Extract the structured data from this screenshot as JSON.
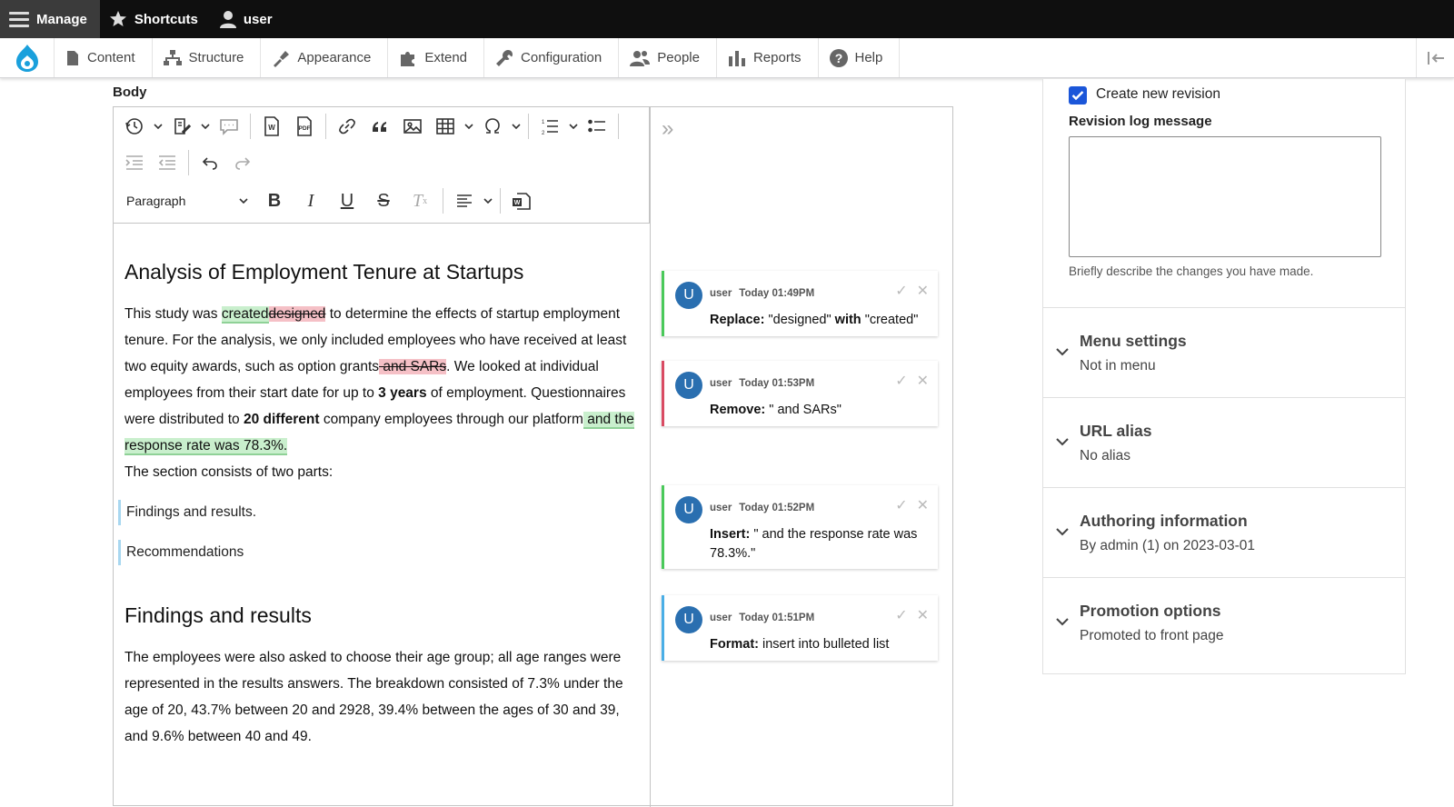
{
  "topbar": {
    "manage": "Manage",
    "shortcuts": "Shortcuts",
    "user": "user"
  },
  "tray": {
    "items": [
      "Content",
      "Structure",
      "Appearance",
      "Extend",
      "Configuration",
      "People",
      "Reports",
      "Help"
    ]
  },
  "editor": {
    "field_label": "Body",
    "paragraph_select": "Paragraph",
    "heading1": "Analysis of Employment Tenure at Startups",
    "p1": {
      "a": "This study was ",
      "ins1": "created",
      "del1": "designed",
      "b": " to determine the effects of startup employment tenure. For the analysis, we only included employees who have received at least two equity awards, such as option grants",
      "del2": " and SARs",
      "c": ". We looked at individual employees from their start date for up to ",
      "bold1": "3 years",
      "d": " of employment. Questionnaires were distributed to ",
      "bold2": "20 different",
      "e": " company employees through our platform",
      "ins2": " and the response rate was 78.3%.",
      "f": "The section consists of two parts:"
    },
    "quote1": "Findings and results.",
    "quote2": "Recommendations",
    "heading2": "Findings and results",
    "p2": "The employees were also asked to choose their age group; all age ranges were represented in the results answers. The breakdown consisted of 7.3% under the age of 20, 43.7% between 20 and 2928, 39.4% between the ages of 30 and 39, and 9.6% between 40 and 49."
  },
  "suggestions": [
    {
      "avatar": "U",
      "user": "user",
      "time": "Today 01:49PM",
      "label": "Replace:",
      "text": " \"designed\" ",
      "label2": "with",
      "text2": " \"created\"",
      "color": "#4ac95a"
    },
    {
      "avatar": "U",
      "user": "user",
      "time": "Today 01:53PM",
      "label": "Remove:",
      "text": " \" and SARs\"",
      "color": "#d94b63"
    },
    {
      "avatar": "U",
      "user": "user",
      "time": "Today 01:52PM",
      "label": "Insert:",
      "text": " \" and the response rate was 78.3%.\"",
      "color": "#4ac95a"
    },
    {
      "avatar": "U",
      "user": "user",
      "time": "Today 01:51PM",
      "label": "Format:",
      "text": " insert into bulleted list",
      "color": "#4aaee6"
    }
  ],
  "meta": {
    "revision_checkbox": "Create new revision",
    "revision_checked": true,
    "log_label": "Revision log message",
    "log_value": "",
    "log_help": "Briefly describe the changes you have made.",
    "sections": [
      {
        "title": "Menu settings",
        "summary": "Not in menu"
      },
      {
        "title": "URL alias",
        "summary": "No alias"
      },
      {
        "title": "Authoring information",
        "summary": "By admin (1) on 2023-03-01"
      },
      {
        "title": "Promotion options",
        "summary": "Promoted to front page"
      }
    ]
  },
  "colors": {
    "topbar": "#0f0f0f",
    "accent": "#1b56d9",
    "insert_bg": "#c9efcd",
    "delete_bg": "#f5c0c6"
  }
}
